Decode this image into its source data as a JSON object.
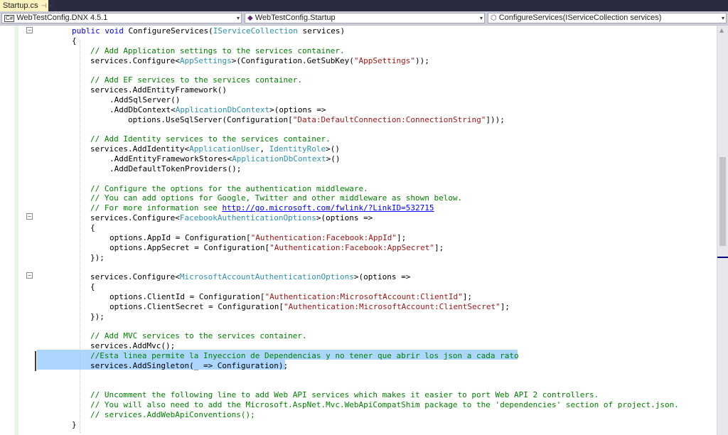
{
  "tab": {
    "title": "Startup.cs",
    "pin_glyph": "⊣",
    "close_glyph": "×"
  },
  "navbar": {
    "project": "WebTestConfig.DNX 4.5.1",
    "project_icon": "C#",
    "class": "WebTestConfig.Startup",
    "member": "ConfigureServices(IServiceCollection services)",
    "arrow": "▾"
  },
  "collapse_glyph": "−",
  "code_lines": [
    [
      [
        "k",
        "public "
      ],
      [
        "k",
        "void "
      ],
      [
        "p",
        "ConfigureServices("
      ],
      [
        "t",
        "IServiceCollection"
      ],
      [
        "p",
        " services)"
      ]
    ],
    [
      [
        "p",
        "{"
      ]
    ],
    [
      [
        "c",
        "// Add Application settings to the services container."
      ]
    ],
    [
      [
        "p",
        "services.Configure<"
      ],
      [
        "t",
        "AppSettings"
      ],
      [
        "p",
        ">(Configuration.GetSubKey("
      ],
      [
        "s",
        "\"AppSettings\""
      ],
      [
        "p",
        "));"
      ]
    ],
    [],
    [
      [
        "c",
        "// Add EF services to the services container."
      ]
    ],
    [
      [
        "p",
        "services.AddEntityFramework()"
      ]
    ],
    [
      [
        "p",
        ".AddSqlServer()"
      ]
    ],
    [
      [
        "p",
        ".AddDbContext<"
      ],
      [
        "t",
        "ApplicationDbContext"
      ],
      [
        "p",
        ">(options =>"
      ]
    ],
    [
      [
        "p",
        "options.UseSqlServer(Configuration["
      ],
      [
        "s",
        "\"Data:DefaultConnection:ConnectionString\""
      ],
      [
        "p",
        "]));"
      ]
    ],
    [],
    [
      [
        "c",
        "// Add Identity services to the services container."
      ]
    ],
    [
      [
        "p",
        "services.AddIdentity<"
      ],
      [
        "t",
        "ApplicationUser"
      ],
      [
        "p",
        ", "
      ],
      [
        "t",
        "IdentityRole"
      ],
      [
        "p",
        ">()"
      ]
    ],
    [
      [
        "p",
        ".AddEntityFrameworkStores<"
      ],
      [
        "t",
        "ApplicationDbContext"
      ],
      [
        "p",
        ">()"
      ]
    ],
    [
      [
        "p",
        ".AddDefaultTokenProviders();"
      ]
    ],
    [],
    [
      [
        "c",
        "// Configure the options for the authentication middleware."
      ]
    ],
    [
      [
        "c",
        "// You can add options for Google, Twitter and other middleware as shown below."
      ]
    ],
    [
      [
        "c",
        "// For more information see "
      ],
      [
        "u",
        "http://go.microsoft.com/fwlink/?LinkID=532715"
      ]
    ],
    [
      [
        "p",
        "services.Configure<"
      ],
      [
        "t",
        "FacebookAuthenticationOptions"
      ],
      [
        "p",
        ">(options =>"
      ]
    ],
    [
      [
        "p",
        "{"
      ]
    ],
    [
      [
        "p",
        "options.AppId = Configuration["
      ],
      [
        "s",
        "\"Authentication:Facebook:AppId\""
      ],
      [
        "p",
        "];"
      ]
    ],
    [
      [
        "p",
        "options.AppSecret = Configuration["
      ],
      [
        "s",
        "\"Authentication:Facebook:AppSecret\""
      ],
      [
        "p",
        "];"
      ]
    ],
    [
      [
        "p",
        "});"
      ]
    ],
    [],
    [
      [
        "p",
        "services.Configure<"
      ],
      [
        "t",
        "MicrosoftAccountAuthenticationOptions"
      ],
      [
        "p",
        ">(options =>"
      ]
    ],
    [
      [
        "p",
        "{"
      ]
    ],
    [
      [
        "p",
        "options.ClientId = Configuration["
      ],
      [
        "s",
        "\"Authentication:MicrosoftAccount:ClientId\""
      ],
      [
        "p",
        "];"
      ]
    ],
    [
      [
        "p",
        "options.ClientSecret = Configuration["
      ],
      [
        "s",
        "\"Authentication:MicrosoftAccount:ClientSecret\""
      ],
      [
        "p",
        "];"
      ]
    ],
    [
      [
        "p",
        "});"
      ]
    ],
    [],
    [
      [
        "c",
        "// Add MVC services to the services container."
      ]
    ],
    [
      [
        "p",
        "services.AddMvc();"
      ]
    ],
    [
      [
        "c",
        "//Esta linea permite la Inyeccion de Dependencias y no tener que abrir los json a cada rato"
      ]
    ],
    [
      [
        "p",
        "services.AddSingleton(_ => Configuration);"
      ]
    ],
    [],
    [],
    [
      [
        "c",
        "// Uncomment the following line to add Web API services which makes it easier to port Web API 2 controllers."
      ]
    ],
    [
      [
        "c",
        "// You will also need to add the Microsoft.AspNet.Mvc.WebApiCompatShim package to the 'dependencies' section of project.json."
      ]
    ],
    [
      [
        "c",
        "// services.AddWebApiConventions();"
      ]
    ],
    [
      [
        "p",
        "}"
      ]
    ]
  ]
}
